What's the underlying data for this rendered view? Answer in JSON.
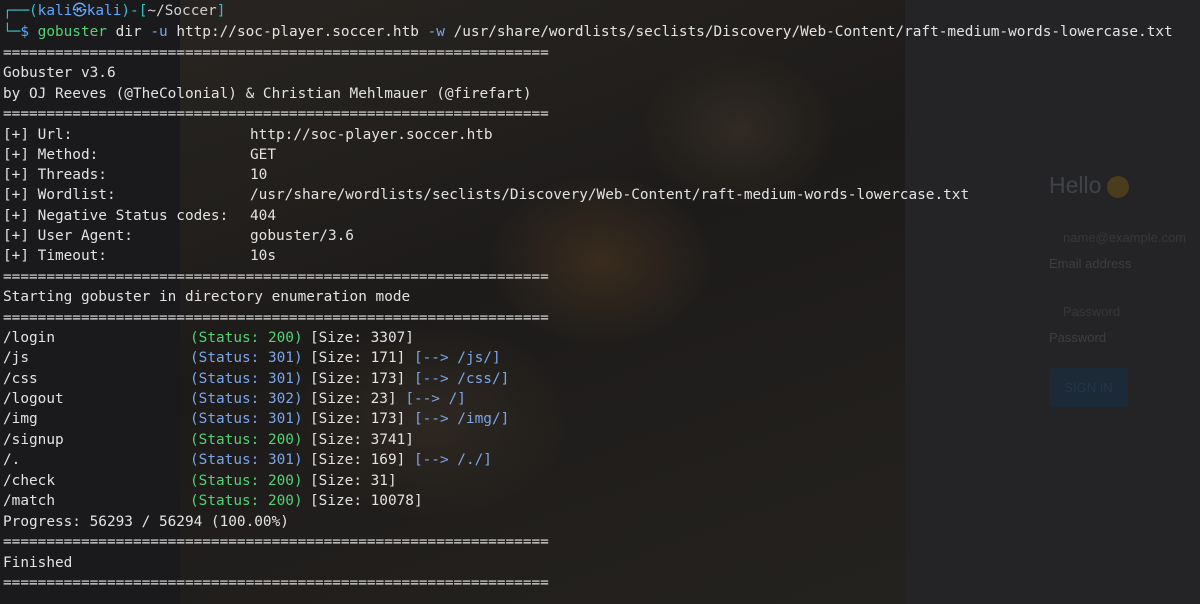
{
  "prompt": {
    "user": "kali",
    "host": "kali",
    "skull_glyph": "㉿",
    "path": "~/Soccer",
    "command": "gobuster",
    "args_dir": "dir",
    "flag_u": "-u",
    "url": "http://soc-player.soccer.htb",
    "flag_w": "-w",
    "wordlist": "/usr/share/wordlists/seclists/Discovery/Web-Content/raft-medium-words-lowercase.txt"
  },
  "separator": "===============================================================",
  "banner": {
    "version": "Gobuster v3.6",
    "authors": "by OJ Reeves (@TheColonial) & Christian Mehlmauer (@firefart)"
  },
  "config": [
    {
      "key": "[+] Url:",
      "value": "http://soc-player.soccer.htb"
    },
    {
      "key": "[+] Method:",
      "value": "GET"
    },
    {
      "key": "[+] Threads:",
      "value": "10"
    },
    {
      "key": "[+] Wordlist:",
      "value": "/usr/share/wordlists/seclists/Discovery/Web-Content/raft-medium-words-lowercase.txt"
    },
    {
      "key": "[+] Negative Status codes:",
      "value": "404"
    },
    {
      "key": "[+] User Agent:",
      "value": "gobuster/3.6"
    },
    {
      "key": "[+] Timeout:",
      "value": "10s"
    }
  ],
  "mode_line": "Starting gobuster in directory enumeration mode",
  "results": [
    {
      "path": "/login",
      "status": "(Status: 200)",
      "size": "[Size: 3307]",
      "redirect": ""
    },
    {
      "path": "/js",
      "status": "(Status: 301)",
      "size": "[Size: 171]",
      "redirect": "[--> /js/]"
    },
    {
      "path": "/css",
      "status": "(Status: 301)",
      "size": "[Size: 173]",
      "redirect": "[--> /css/]"
    },
    {
      "path": "/logout",
      "status": "(Status: 302)",
      "size": "[Size: 23]",
      "redirect": "[--> /]"
    },
    {
      "path": "/img",
      "status": "(Status: 301)",
      "size": "[Size: 173]",
      "redirect": "[--> /img/]"
    },
    {
      "path": "/signup",
      "status": "(Status: 200)",
      "size": "[Size: 3741]",
      "redirect": ""
    },
    {
      "path": "/.",
      "status": "(Status: 301)",
      "size": "[Size: 169]",
      "redirect": "[--> /./]"
    },
    {
      "path": "/check",
      "status": "(Status: 200)",
      "size": "[Size: 31]",
      "redirect": ""
    },
    {
      "path": "/match",
      "status": "(Status: 200)",
      "size": "[Size: 10078]",
      "redirect": ""
    }
  ],
  "progress": "Progress: 56293 / 56294 (100.00%)",
  "finished": "Finished",
  "background_login": {
    "greeting": "Hello",
    "email_placeholder": "name@example.com",
    "email_label": "Email address",
    "password_placeholder": "Password",
    "password_label": "Password",
    "button": "SIGN IN"
  },
  "colors": {
    "terminal_bg": "#1a1a1c",
    "prompt_cyan": "#34c0c8",
    "prompt_blue": "#5fa8ff",
    "status_green": "#52d273",
    "redirect_blue": "#7aa6e8"
  }
}
